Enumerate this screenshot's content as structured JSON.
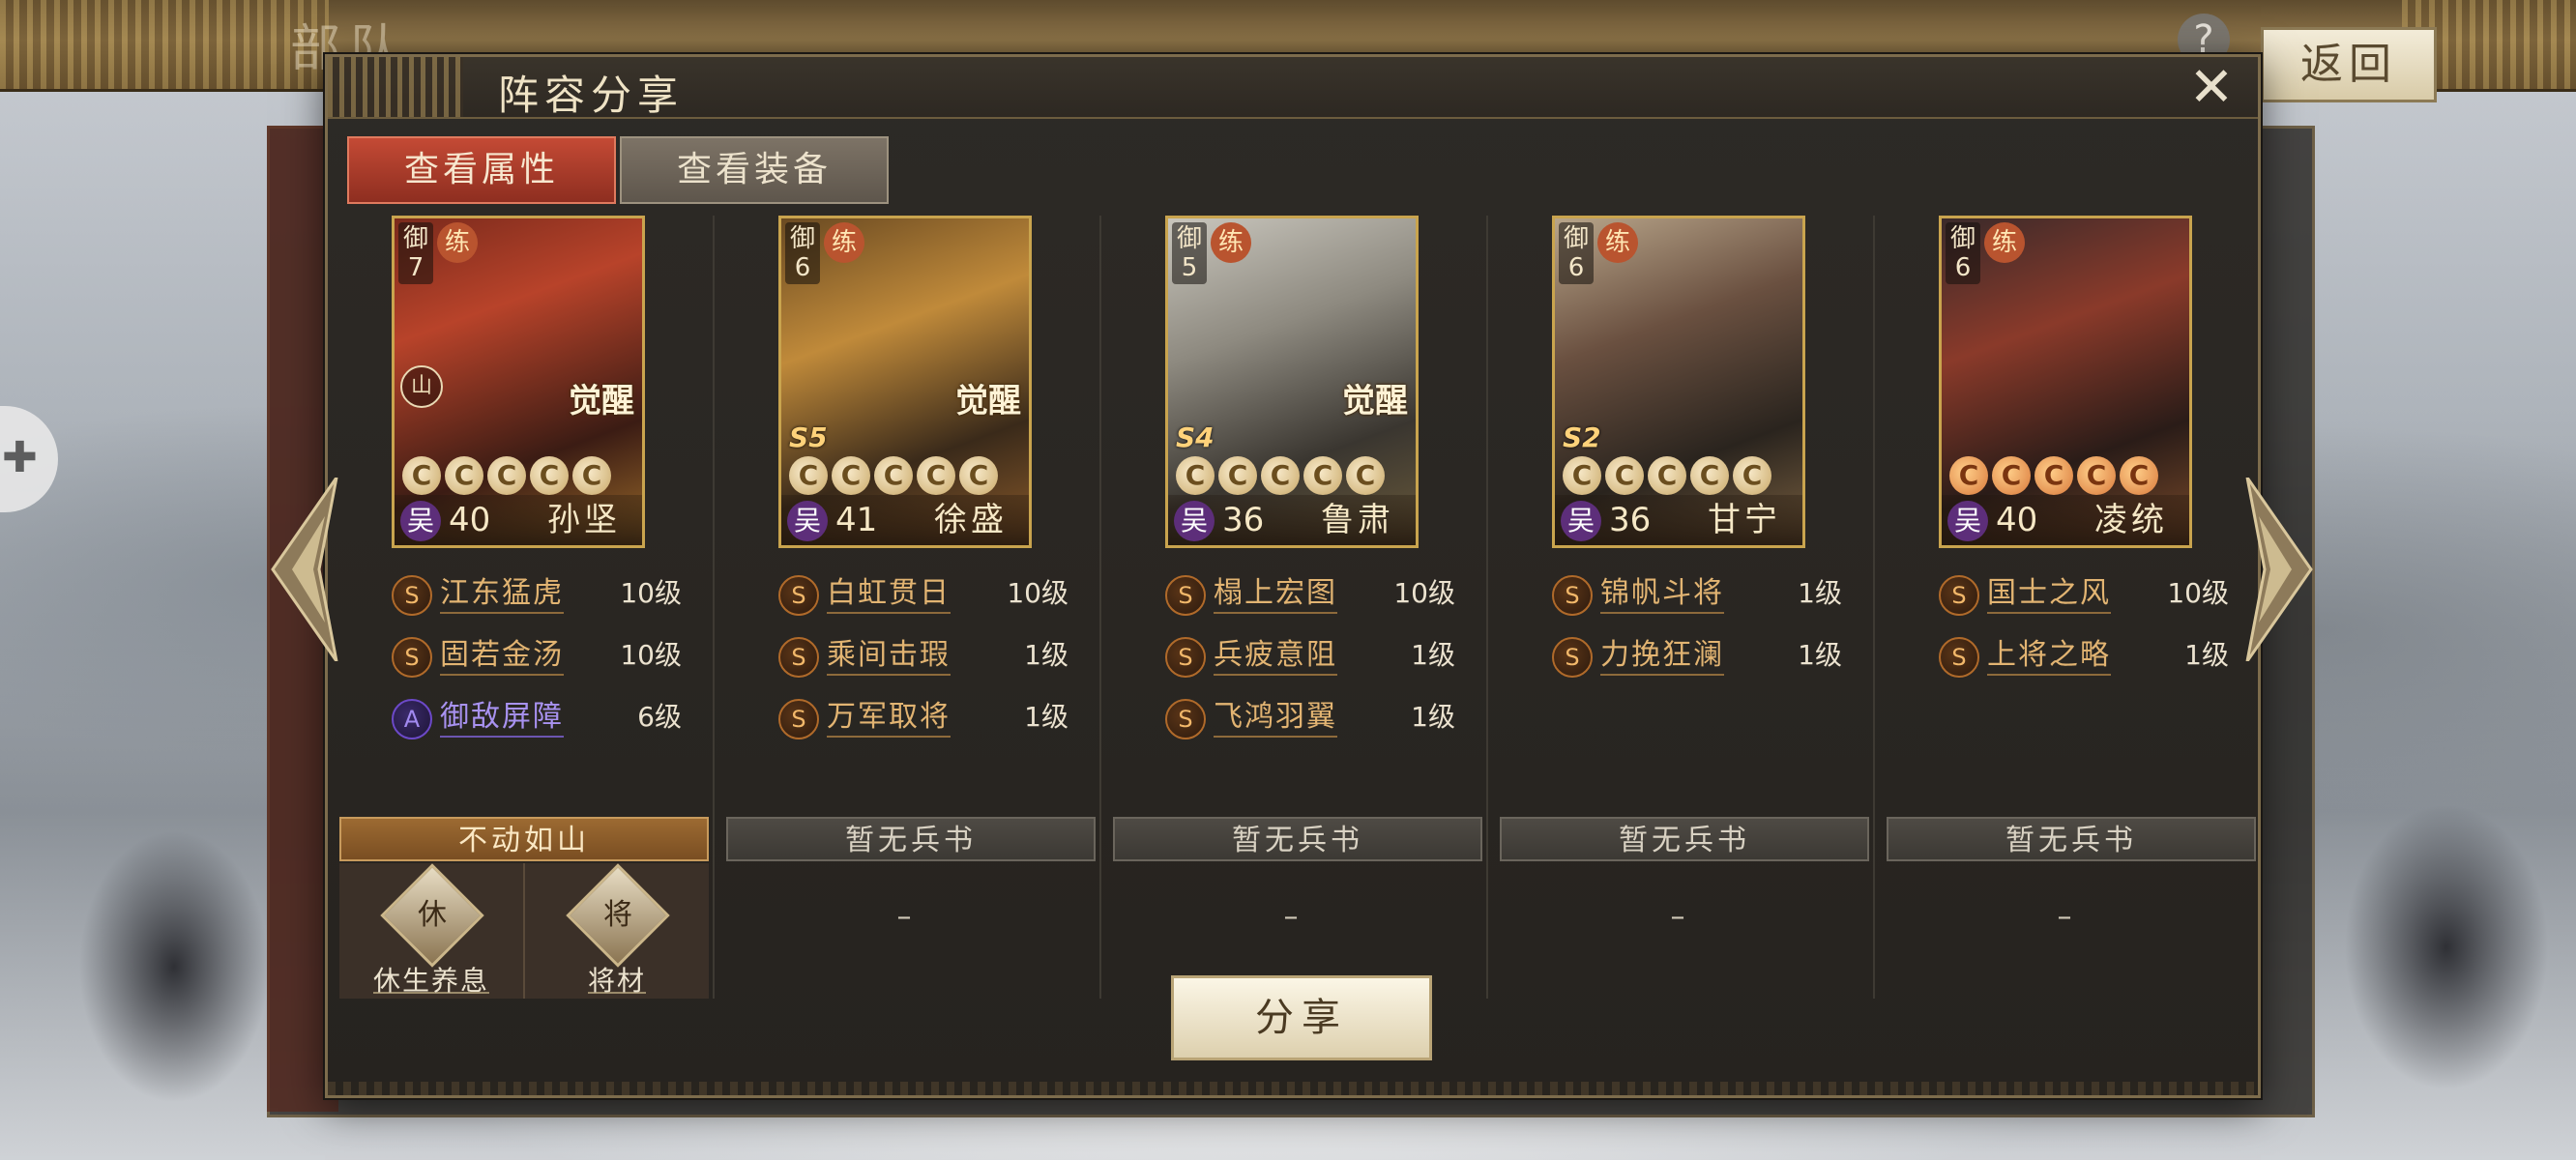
{
  "background": {
    "page_title": "部队",
    "help_label": "?",
    "return_label": "返回"
  },
  "dialog": {
    "title": "阵容分享",
    "close_label": "✕",
    "tabs": [
      {
        "label": "查看属性",
        "active": true
      },
      {
        "label": "查看装备",
        "active": false
      }
    ],
    "share_label": "分享",
    "generals": [
      {
        "level_label": "御",
        "level": "7",
        "badge": "练",
        "awaken": "觉醒",
        "star_rank": "",
        "mount": "山",
        "star_color": "gold",
        "stars": [
          "C",
          "C",
          "C",
          "C",
          "C"
        ],
        "faction": "吴",
        "cost": "40",
        "name": "孙坚",
        "skills": [
          {
            "grade": "S",
            "name": "江东猛虎",
            "level": "10级"
          },
          {
            "grade": "S",
            "name": "固若金汤",
            "level": "10级"
          },
          {
            "grade": "A",
            "name": "御敌屏障",
            "level": "6级"
          }
        ],
        "book": {
          "title": "不动如山",
          "items": [
            {
              "icon": "休",
              "label": "休生养息"
            },
            {
              "icon": "将",
              "label": "将材"
            }
          ]
        }
      },
      {
        "level_label": "御",
        "level": "6",
        "badge": "练",
        "awaken": "觉醒",
        "star_rank": "S5",
        "mount": "",
        "star_color": "gold",
        "stars": [
          "C",
          "C",
          "C",
          "C",
          "C"
        ],
        "faction": "吴",
        "cost": "41",
        "name": "徐盛",
        "skills": [
          {
            "grade": "S",
            "name": "白虹贯日",
            "level": "10级"
          },
          {
            "grade": "S",
            "name": "乘间击瑕",
            "level": "1级"
          },
          {
            "grade": "S",
            "name": "万军取将",
            "level": "1级"
          }
        ],
        "book": {
          "title": "暂无兵书",
          "empty": "–"
        }
      },
      {
        "level_label": "御",
        "level": "5",
        "badge": "练",
        "awaken": "觉醒",
        "star_rank": "S4",
        "mount": "",
        "star_color": "gold",
        "stars": [
          "C",
          "C",
          "C",
          "C",
          "C"
        ],
        "faction": "吴",
        "cost": "36",
        "name": "鲁肃",
        "skills": [
          {
            "grade": "S",
            "name": "榻上宏图",
            "level": "10级"
          },
          {
            "grade": "S",
            "name": "兵疲意阻",
            "level": "1级"
          },
          {
            "grade": "S",
            "name": "飞鸿羽翼",
            "level": "1级"
          }
        ],
        "book": {
          "title": "暂无兵书",
          "empty": "–"
        }
      },
      {
        "level_label": "御",
        "level": "6",
        "badge": "练",
        "awaken": "",
        "star_rank": "S2",
        "mount": "",
        "star_color": "gold",
        "stars": [
          "C",
          "C",
          "C",
          "C",
          "C"
        ],
        "faction": "吴",
        "cost": "36",
        "name": "甘宁",
        "skills": [
          {
            "grade": "S",
            "name": "锦帆斗将",
            "level": "1级"
          },
          {
            "grade": "S",
            "name": "力挽狂澜",
            "level": "1级"
          }
        ],
        "book": {
          "title": "暂无兵书",
          "empty": "–"
        }
      },
      {
        "level_label": "御",
        "level": "6",
        "badge": "练",
        "awaken": "",
        "star_rank": "",
        "mount": "",
        "star_color": "orange",
        "stars": [
          "C",
          "C",
          "C",
          "C",
          "C"
        ],
        "faction": "吴",
        "cost": "40",
        "name": "凌统",
        "skills": [
          {
            "grade": "S",
            "name": "国士之风",
            "level": "10级"
          },
          {
            "grade": "S",
            "name": "上将之略",
            "level": "1级"
          }
        ],
        "book": {
          "title": "暂无兵书",
          "empty": "–"
        }
      }
    ]
  }
}
